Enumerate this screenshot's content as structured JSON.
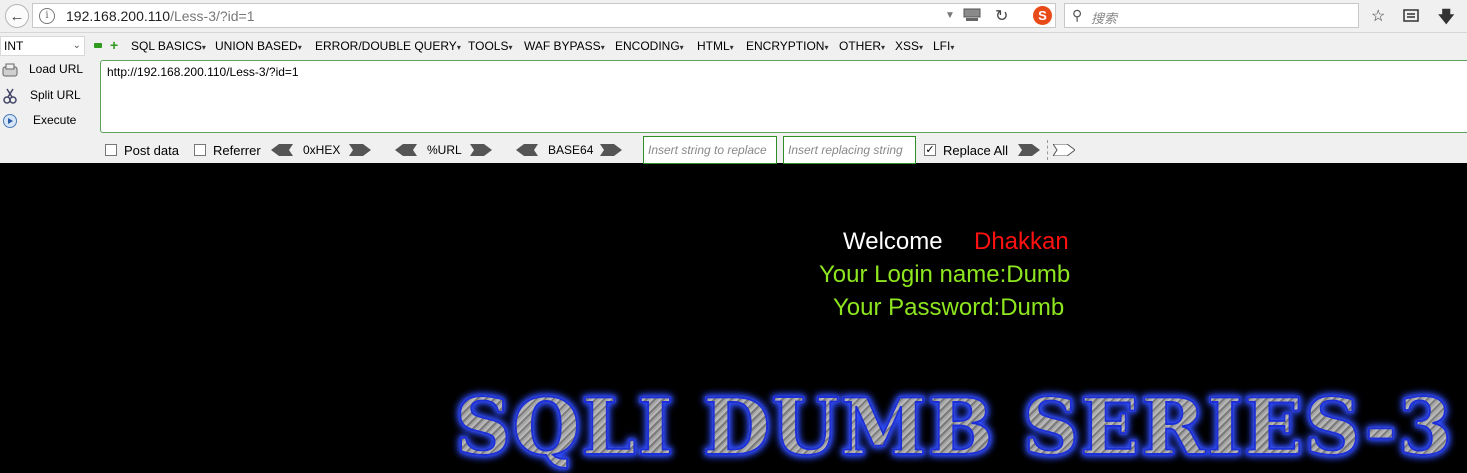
{
  "navbar": {
    "url_host": "192.168.200.110",
    "url_path": "/Less-3/?id=1",
    "search_placeholder": "搜索",
    "back_icon": "back-arrow-icon",
    "reload_icon": "reload-icon"
  },
  "hackbar": {
    "select_value": "INT",
    "menus": [
      "SQL BASICS",
      "UNION BASED",
      "ERROR/DOUBLE QUERY",
      "TOOLS",
      "WAF BYPASS",
      "ENCODING",
      "HTML",
      "ENCRYPTION",
      "OTHER",
      "XSS",
      "LFI"
    ],
    "load_url": "Load URL",
    "split_url": "Split URL",
    "execute": "Execute",
    "url_value": "http://192.168.200.110/Less-3/?id=1",
    "post_data": "Post data",
    "referrer": "Referrer",
    "hex": "0xHEX",
    "url_enc": "%URL",
    "base64": "BASE64",
    "insert_placeholder": "Insert string to replace",
    "replacing_placeholder": "Insert replacing string",
    "replace_all": "Replace All",
    "post_checked": false,
    "referrer_checked": false,
    "replace_all_checked": true
  },
  "content": {
    "welcome": "Welcome",
    "user": "Dhakkan",
    "login_line": "Your Login name:Dumb",
    "password_line": "Your Password:Dumb",
    "banner": "SQLI DUMB SERIES-3",
    "colors": {
      "welcome": "#ffffff",
      "user": "#ff1111",
      "info": "#8ee61f",
      "banner_outline": "#1c2fd8"
    }
  }
}
